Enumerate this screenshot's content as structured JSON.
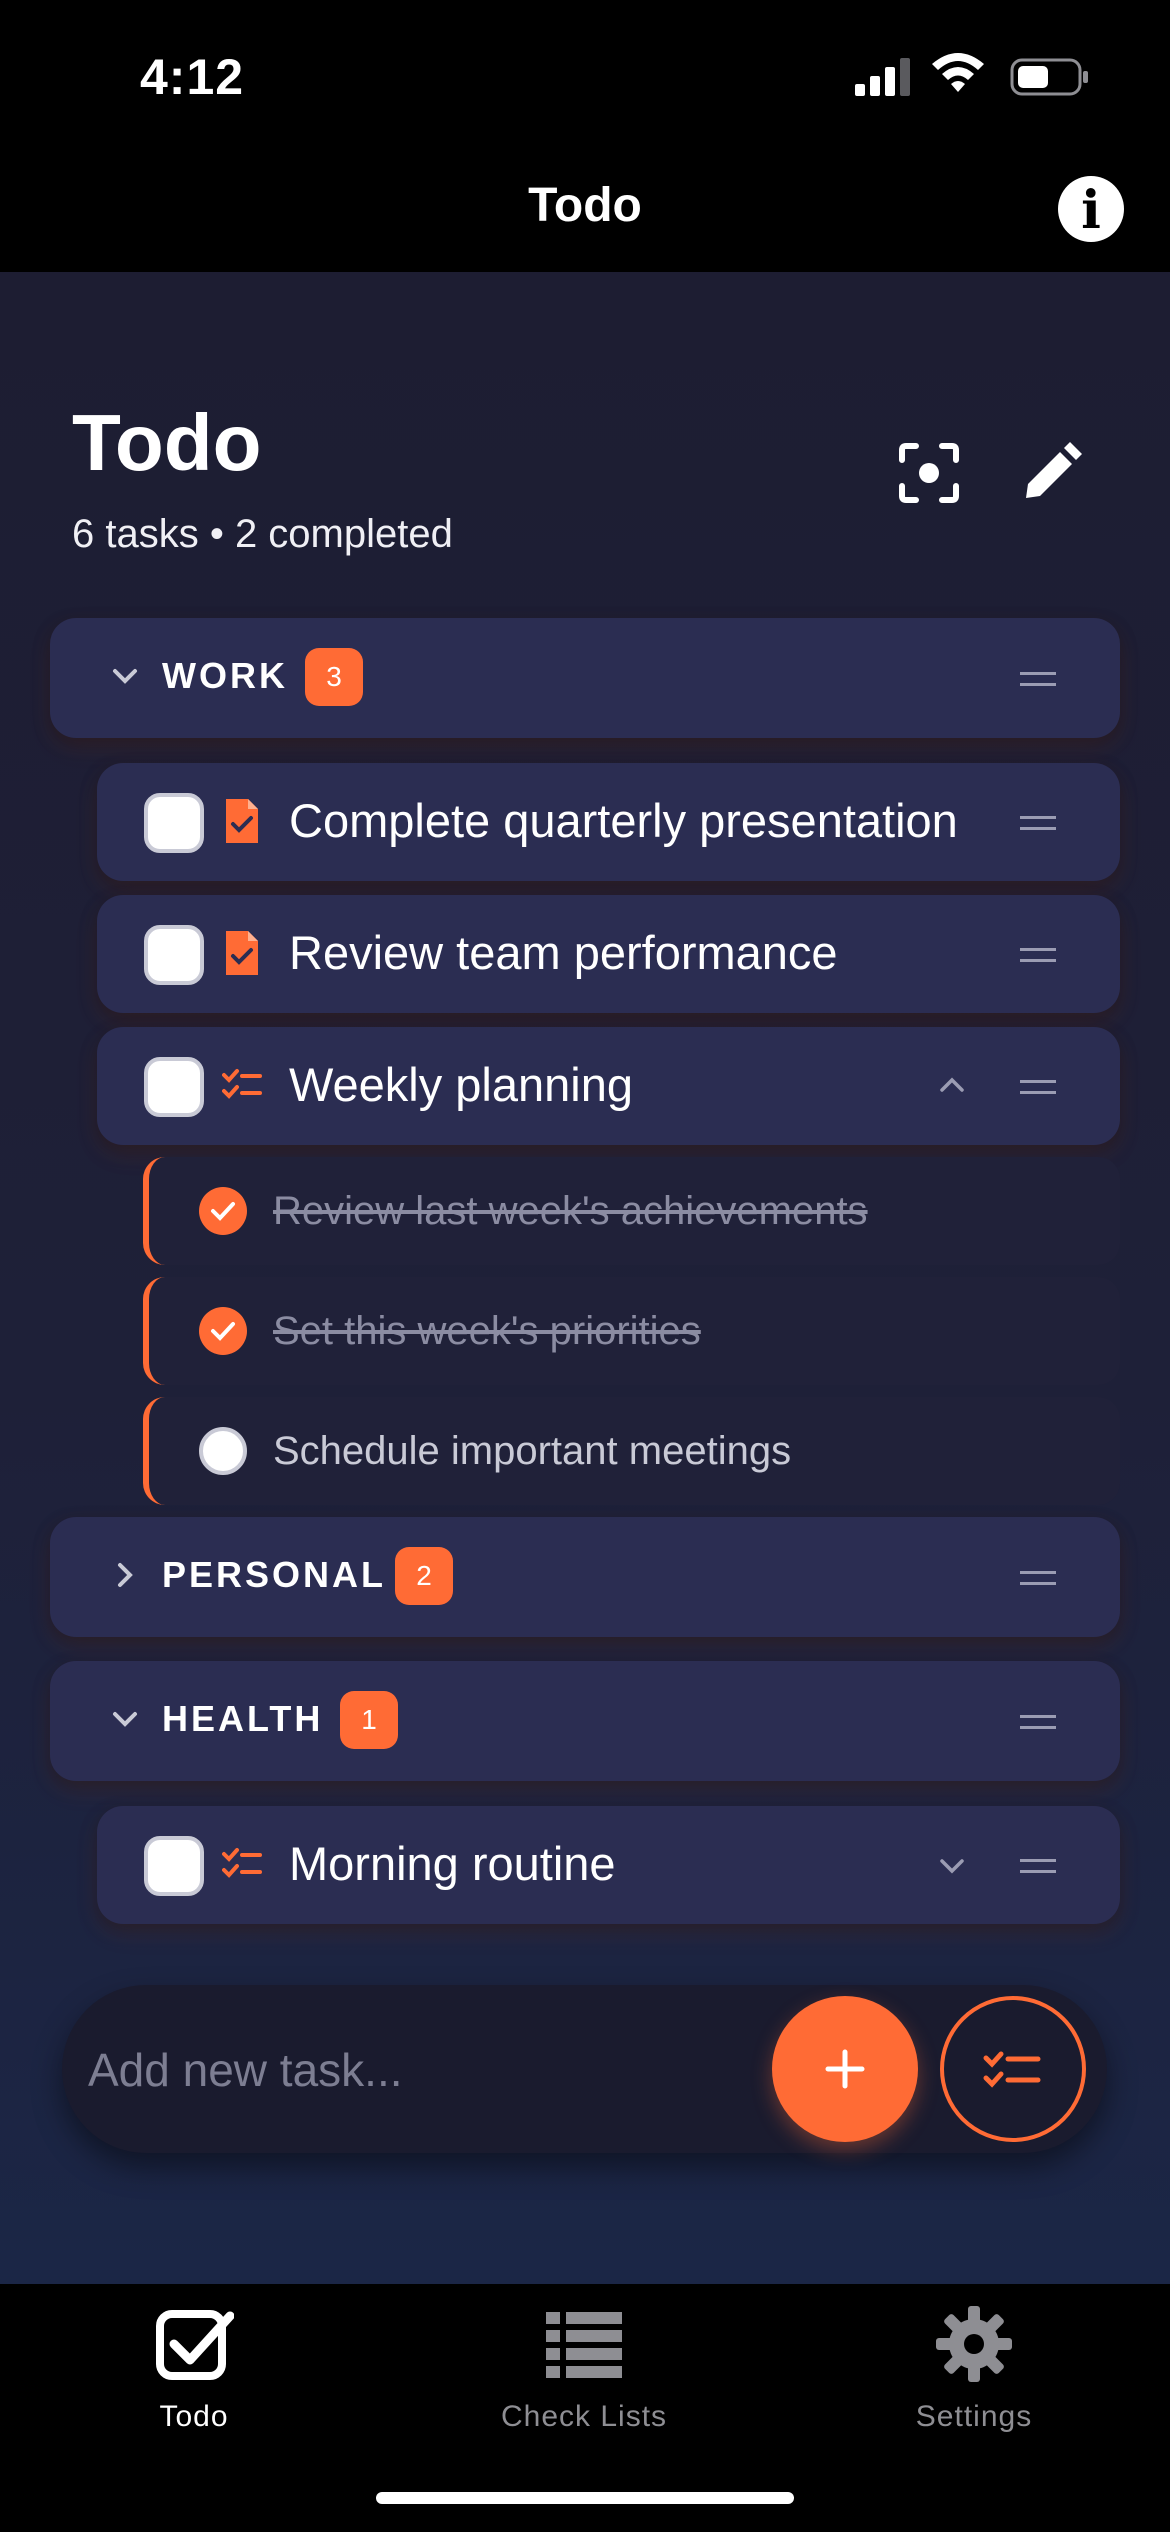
{
  "status_bar": {
    "time": "4:12"
  },
  "nav": {
    "title": "Todo",
    "info_icon": "info-icon"
  },
  "header": {
    "title": "Todo",
    "subtitle": "6 tasks • 2 completed",
    "focus_icon": "focus-mode-icon",
    "edit_icon": "pencil-icon"
  },
  "categories": [
    {
      "name": "WORK",
      "count": "3",
      "expanded": true
    },
    {
      "name": "PERSONAL",
      "count": "2",
      "expanded": false
    },
    {
      "name": "HEALTH",
      "count": "1",
      "expanded": true
    }
  ],
  "tasks": [
    {
      "text": "Complete quarterly presentation",
      "icon": "document-check-icon",
      "done": false
    },
    {
      "text": "Review team performance",
      "icon": "document-check-icon",
      "done": false
    },
    {
      "text": "Weekly planning",
      "icon": "checklist-icon",
      "done": false,
      "expanded": true
    },
    {
      "text": "Morning routine",
      "icon": "checklist-icon",
      "done": false,
      "expanded": false
    }
  ],
  "subtasks": [
    {
      "text": "Review last week's achievements",
      "done": true
    },
    {
      "text": "Set this week's priorities",
      "done": true
    },
    {
      "text": "Schedule important meetings",
      "done": false
    }
  ],
  "composer": {
    "placeholder": "Add new task..."
  },
  "tabs": [
    {
      "label": "Todo",
      "icon": "checkbox-icon",
      "active": true
    },
    {
      "label": "Check Lists",
      "icon": "list-icon",
      "active": false
    },
    {
      "label": "Settings",
      "icon": "gear-icon",
      "active": false
    }
  ],
  "colors": {
    "accent": "#ff6b35",
    "card": "#2b2d52",
    "background_top": "#1d1d32",
    "background_bottom": "#1b2646",
    "subtask_bg": "#202139"
  }
}
